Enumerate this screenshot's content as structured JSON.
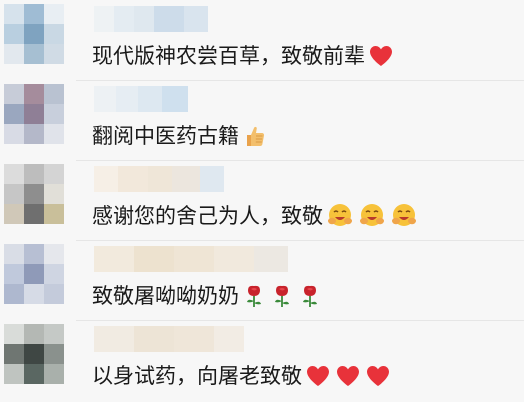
{
  "comments": [
    {
      "text": "现代版神农尝百草，致敬前辈",
      "emoji": "heart",
      "count": 1
    },
    {
      "text": "翻阅中医药古籍",
      "emoji": "thumb",
      "count": 1
    },
    {
      "text": "感谢您的舍己为人，致敬",
      "emoji": "hug",
      "count": 3
    },
    {
      "text": "致敬屠呦呦奶奶",
      "emoji": "rose",
      "count": 3
    },
    {
      "text": "以身试药，向屠老致敬",
      "emoji": "heart",
      "count": 3
    }
  ],
  "colors": {
    "heart": "#e8323a",
    "rose_petal": "#c8232c",
    "rose_leaf": "#3a8a3a",
    "hug_face": "#f7c23a",
    "hand": "#f0b15a"
  }
}
